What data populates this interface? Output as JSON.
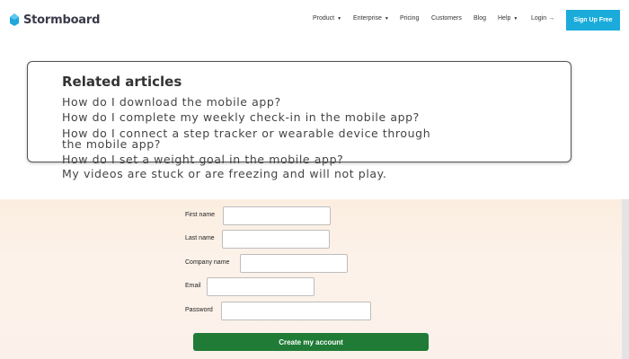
{
  "brand": {
    "logo_text": "Stormboard",
    "accent_color": "#1aabdb",
    "logo_color": "#20a6d8"
  },
  "nav": {
    "product": "Product",
    "enterprise": "Enterprise",
    "pricing": "Pricing",
    "customers": "Customers",
    "blog": "Blog",
    "help": "Help",
    "login": "Login",
    "login_arrow": "→",
    "signup": "Sign Up Free"
  },
  "related": {
    "title": "Related articles",
    "articles": [
      "How do I download the mobile app?",
      "How do I complete my weekly check-in in the mobile app?",
      "How do I connect a step tracker or wearable device through the mobile app?",
      "How do I set a weight goal in the mobile app?",
      "My videos are stuck or are freezing and will not play."
    ]
  },
  "form": {
    "first_name_label": "First name",
    "last_name_label": "Last name",
    "company_label": "Company name",
    "email_label": "Email",
    "password_label": "Password",
    "submit": "Create my account",
    "submit_color": "#1f7b35"
  }
}
